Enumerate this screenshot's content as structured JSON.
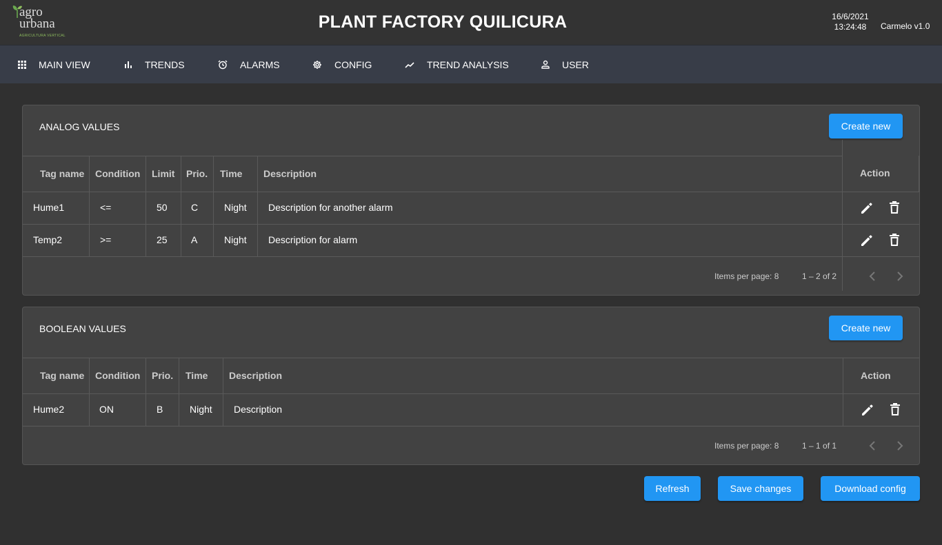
{
  "header": {
    "logo_line1": "agro",
    "logo_line2": "urbana",
    "logo_sub": "AGRICULTURA VERTICAL",
    "title": "PLANT FACTORY QUILICURA",
    "date": "16/6/2021",
    "time": "13:24:48",
    "version": "Carmelo v1.0"
  },
  "nav": {
    "items": [
      {
        "label": "MAIN VIEW",
        "icon": "grid-icon"
      },
      {
        "label": "TRENDS",
        "icon": "bar-chart-icon"
      },
      {
        "label": "ALARMS",
        "icon": "alarm-clock-icon"
      },
      {
        "label": "CONFIG",
        "icon": "gear-icon"
      },
      {
        "label": "TREND ANALYSIS",
        "icon": "trending-up-icon"
      },
      {
        "label": "USER",
        "icon": "person-icon"
      }
    ]
  },
  "analog": {
    "title": "ANALOG VALUES",
    "create_label": "Create new",
    "headers": [
      "Tag name",
      "Condition",
      "Limit",
      "Prio.",
      "Time",
      "Description",
      "Action"
    ],
    "rows": [
      {
        "tag": "Hume1",
        "condition": "<=",
        "limit": "50",
        "prio": "C",
        "time": "Night",
        "description": "Description for another alarm"
      },
      {
        "tag": "Temp2",
        "condition": ">=",
        "limit": "25",
        "prio": "A",
        "time": "Night",
        "description": "Description for alarm"
      }
    ],
    "items_per_page": "Items per page: 8",
    "range": "1 – 2 of 2"
  },
  "boolean": {
    "title": "BOOLEAN VALUES",
    "create_label": "Create new",
    "headers": [
      "Tag name",
      "Condition",
      "Prio.",
      "Time",
      "Description",
      "Action"
    ],
    "rows": [
      {
        "tag": "Hume2",
        "condition": "ON",
        "prio": "B",
        "time": "Night",
        "description": "Description"
      }
    ],
    "items_per_page": "Items per page: 8",
    "range": "1 – 1 of 1"
  },
  "footer": {
    "refresh_label": "Refresh",
    "save_label": "Save changes",
    "download_label": "Download config"
  },
  "colors": {
    "accent": "#2196f3",
    "background": "#303030",
    "card": "#424242",
    "nav": "#383d48"
  }
}
